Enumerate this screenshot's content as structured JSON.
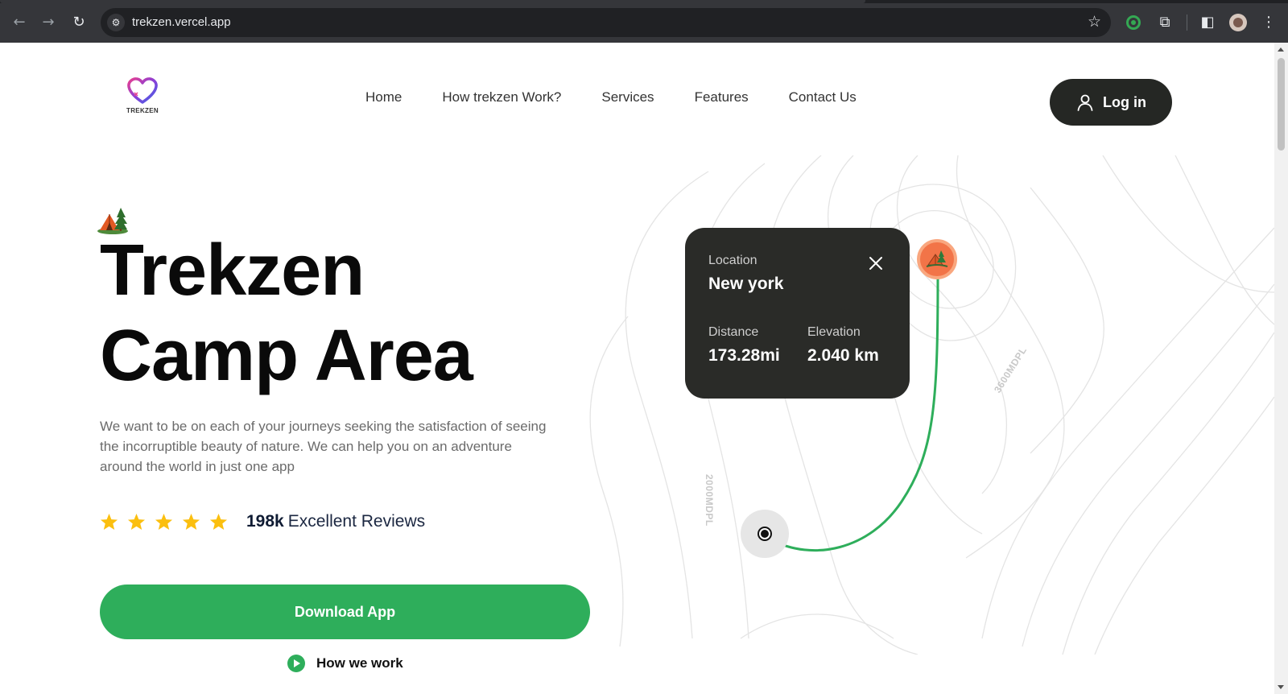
{
  "browser": {
    "url": "trekzen.vercel.app"
  },
  "nav": {
    "logo_text": "TREKZEN",
    "items": [
      "Home",
      "How trekzen Work?",
      "Services",
      "Features",
      "Contact Us"
    ],
    "login_label": "Log in"
  },
  "hero": {
    "title_line1": "Trekzen",
    "title_line2": "Camp Area",
    "description": "We want to be on each of your journeys seeking the satisfaction of seeing the incorruptible beauty of nature. We can help you on an adventure around the world in just one app",
    "rating_stars": 5,
    "rating_count": "198k",
    "rating_label": "Excellent Reviews",
    "download_label": "Download App",
    "how_label": "How we work"
  },
  "map_card": {
    "location_label": "Location",
    "location_value": "New york",
    "distance_label": "Distance",
    "distance_value": "173.28mi",
    "elevation_label": "Elevation",
    "elevation_value": "2.040 km"
  },
  "map_labels": {
    "contour_a": "3600MDPL",
    "contour_b": "2000MDPL"
  },
  "colors": {
    "accent_green": "#2eae5b",
    "dark": "#252724",
    "pin_orange": "#f27448",
    "star_yellow": "#fbbf0f"
  }
}
